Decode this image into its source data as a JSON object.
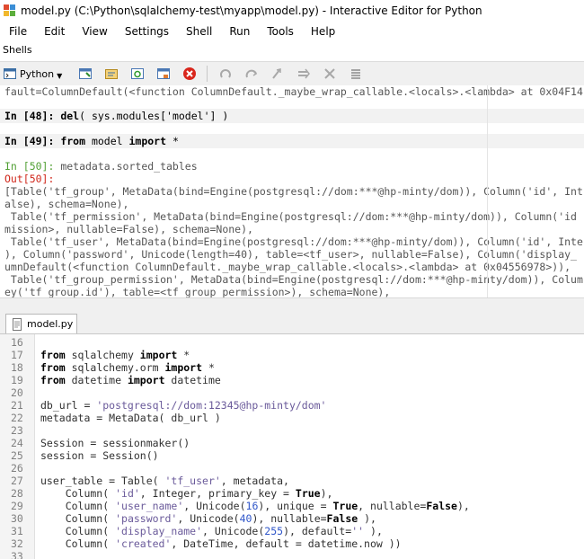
{
  "window": {
    "title": "model.py (C:\\Python\\sqlalchemy-test\\myapp\\model.py) - Interactive Editor for Python"
  },
  "menu": [
    "File",
    "Edit",
    "View",
    "Settings",
    "Shell",
    "Run",
    "Tools",
    "Help"
  ],
  "shells_label": "Shells",
  "toolbar": {
    "language": "Python",
    "buttons": [
      "new-shell-icon",
      "open-icon",
      "refresh-icon",
      "window-icon",
      "stop-icon",
      "undo-icon",
      "redo-icon",
      "step-icon",
      "run-icon",
      "clear-icon",
      "list-icon"
    ]
  },
  "shell": {
    "line0": "fault=ColumnDefault(<function ColumnDefault._maybe_wrap_callable.<locals>.<lambda> at 0x04F14",
    "p48_prompt": "In [48]: ",
    "p48_kw": "del",
    "p48_rest": "( sys.modules['model'] )",
    "p49_prompt": "In [49]: ",
    "p49_kw1": "from",
    "p49_mid": " model ",
    "p49_kw2": "import",
    "p49_rest": " *",
    "p50_prompt": "In [50]: ",
    "p50_rest": "metadata.sorted_tables",
    "out50": "Out[50]:",
    "out_lines": [
      "[Table('tf_group', MetaData(bind=Engine(postgresql://dom:***@hp-minty/dom)), Column('id', Int",
      "alse), schema=None),",
      " Table('tf_permission', MetaData(bind=Engine(postgresql://dom:***@hp-minty/dom)), Column('id",
      "mission>, nullable=False), schema=None),",
      " Table('tf_user', MetaData(bind=Engine(postgresql://dom:***@hp-minty/dom)), Column('id', Inte",
      "), Column('password', Unicode(length=40), table=<tf_user>, nullable=False), Column('display_",
      "umnDefault(<function ColumnDefault._maybe_wrap_callable.<locals>.<lambda> at 0x04556978>)), ",
      " Table('tf_group_permission', MetaData(bind=Engine(postgresql://dom:***@hp-minty/dom)), Colum",
      "ey('tf_group.id'), table=<tf_group_permission>), schema=None),"
    ]
  },
  "editor": {
    "tab_label": "model.py",
    "line_numbers": [
      "16",
      "17",
      "18",
      "19",
      "20",
      "21",
      "22",
      "23",
      "24",
      "25",
      "26",
      "27",
      "28",
      "29",
      "30",
      "31",
      "32",
      "33"
    ],
    "code": {
      "l17a": "from",
      "l17b": " sqlalchemy ",
      "l17c": "import",
      "l17d": " *",
      "l18a": "from",
      "l18b": " sqlalchemy.orm ",
      "l18c": "import",
      "l18d": " *",
      "l19a": "from",
      "l19b": " datetime ",
      "l19c": "import",
      "l19d": " datetime",
      "l21a": "db_url = ",
      "l21b": "'postgresql://dom:12345@hp-minty/dom'",
      "l22": "metadata = MetaData( db_url )",
      "l24": "Session = sessionmaker()",
      "l25": "session = Session()",
      "l27a": "user_table = Table( ",
      "l27b": "'tf_user'",
      "l27c": ", metadata,",
      "l28a": "    Column( ",
      "l28b": "'id'",
      "l28c": ", Integer, primary_key = ",
      "l28d": "True",
      "l28e": "),",
      "l29a": "    Column( ",
      "l29b": "'user_name'",
      "l29c": ", Unicode(",
      "l29d": "16",
      "l29e": "), unique = ",
      "l29f": "True",
      "l29g": ", nullable=",
      "l29h": "False",
      "l29i": "),",
      "l30a": "    Column( ",
      "l30b": "'password'",
      "l30c": ", Unicode(",
      "l30d": "40",
      "l30e": "), nullable=",
      "l30f": "False",
      "l30g": " ),",
      "l31a": "    Column( ",
      "l31b": "'display_name'",
      "l31c": ", Unicode(",
      "l31d": "255",
      "l31e": "), default=",
      "l31f": "''",
      "l31g": " ),",
      "l32a": "    Column( ",
      "l32b": "'created'",
      "l32c": ", DateTime, default = datetime.now ))"
    }
  },
  "colors": {
    "string": "#6a5a9a",
    "number": "#2f56c9",
    "out_prompt": "#d0271b",
    "in_prompt_green": "#52a035",
    "stop": "#d9261c"
  }
}
